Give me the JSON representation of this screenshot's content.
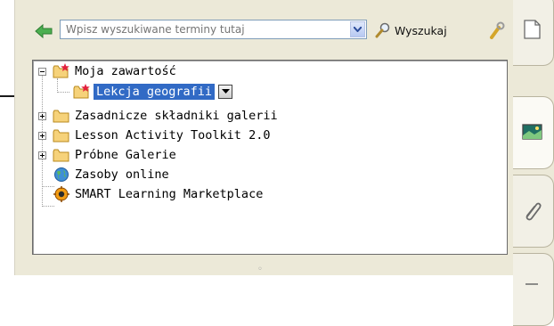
{
  "search": {
    "placeholder": "Wpisz wyszukiwane terminy tutaj",
    "button_label": "Wyszukaj"
  },
  "tree": {
    "root": {
      "label": "Moja zawartość",
      "icon": "folder-star-icon"
    },
    "items": [
      {
        "label": "Lekcja geografii",
        "icon": "folder-star-icon",
        "selected": true
      },
      {
        "label": "Zasadnicze składniki galerii",
        "icon": "folder-icon"
      },
      {
        "label": "Lesson Activity Toolkit 2.0",
        "icon": "folder-icon"
      },
      {
        "label": "Próbne Galerie",
        "icon": "folder-icon"
      },
      {
        "label": "Zasoby online",
        "icon": "globe-icon"
      },
      {
        "label": "SMART Learning Marketplace",
        "icon": "marketplace-icon"
      }
    ]
  },
  "side_tabs": [
    {
      "name": "page-sorter",
      "icon": "page-icon"
    },
    {
      "name": "gallery",
      "icon": "picture-icon"
    },
    {
      "name": "attachments",
      "icon": "paperclip-icon"
    },
    {
      "name": "properties",
      "icon": "properties-icon"
    }
  ],
  "colors": {
    "panel_bg": "#ece9d8",
    "selection": "#316ac5",
    "back_arrow": "#2f9a3b"
  }
}
